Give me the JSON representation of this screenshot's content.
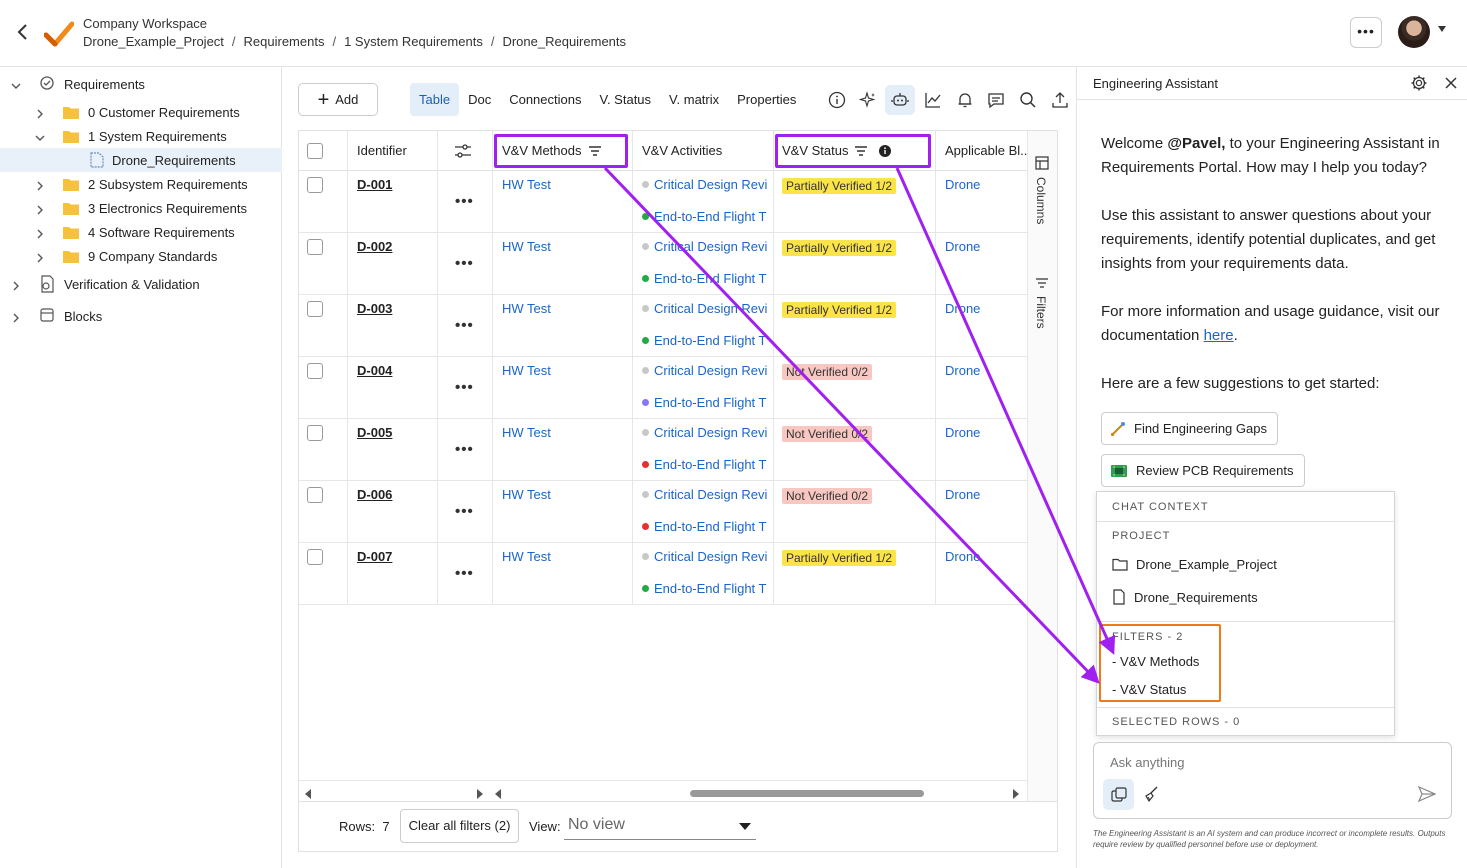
{
  "header": {
    "workspace": "Company Workspace",
    "breadcrumbs": [
      "Drone_Example_Project",
      "Requirements",
      "1 System Requirements",
      "Drone_Requirements"
    ],
    "more_label": "•••"
  },
  "sidebar": {
    "items": [
      {
        "label": "Requirements"
      },
      {
        "label": "0 Customer Requirements"
      },
      {
        "label": "1 System Requirements"
      },
      {
        "label": "Drone_Requirements"
      },
      {
        "label": "2 Subsystem Requirements"
      },
      {
        "label": "3 Electronics Requirements"
      },
      {
        "label": "4 Software Requirements"
      },
      {
        "label": "9 Company Standards"
      },
      {
        "label": "Verification & Validation"
      },
      {
        "label": "Blocks"
      }
    ]
  },
  "toolbar": {
    "add_label": "Add",
    "tabs": [
      "Table",
      "Doc",
      "Connections",
      "V. Status",
      "V. matrix",
      "Properties"
    ],
    "active_tab": "Table"
  },
  "table": {
    "columns": [
      "Identifier",
      "V&V Methods",
      "V&V Activities",
      "V&V Status",
      "Applicable Bl..."
    ],
    "rows": [
      {
        "id": "D-001",
        "method": "HW Test",
        "act1": "Critical Design Revi",
        "act2": "End-to-End Flight T",
        "act2_color": "#22aa44",
        "status": "Partially Verified 1/2",
        "status_kind": "partial",
        "block": "Drone"
      },
      {
        "id": "D-002",
        "method": "HW Test",
        "act1": "Critical Design Revi",
        "act2": "End-to-End Flight T",
        "act2_color": "#22aa44",
        "status": "Partially Verified 1/2",
        "status_kind": "partial",
        "block": "Drone"
      },
      {
        "id": "D-003",
        "method": "HW Test",
        "act1": "Critical Design Revi",
        "act2": "End-to-End Flight T",
        "act2_color": "#22aa44",
        "status": "Partially Verified 1/2",
        "status_kind": "partial",
        "block": "Drone"
      },
      {
        "id": "D-004",
        "method": "HW Test",
        "act1": "Critical Design Revi",
        "act2": "End-to-End Flight T",
        "act2_color": "#8877ee",
        "status": "Not Verified 0/2",
        "status_kind": "not",
        "block": "Drone"
      },
      {
        "id": "D-005",
        "method": "HW Test",
        "act1": "Critical Design Revi",
        "act2": "End-to-End Flight T",
        "act2_color": "#e53030",
        "status": "Not Verified 0/2",
        "status_kind": "not",
        "block": "Drone"
      },
      {
        "id": "D-006",
        "method": "HW Test",
        "act1": "Critical Design Revi",
        "act2": "End-to-End Flight T",
        "act2_color": "#e53030",
        "status": "Not Verified 0/2",
        "status_kind": "not",
        "block": "Drone"
      },
      {
        "id": "D-007",
        "method": "HW Test",
        "act1": "Critical Design Revi",
        "act2": "End-to-End Flight T",
        "act2_color": "#22aa44",
        "status": "Partially Verified 1/2",
        "status_kind": "partial",
        "block": "Drone"
      }
    ],
    "rail_columns": "Columns",
    "rail_filters": "Filters"
  },
  "footer": {
    "rows_label": "Rows:",
    "rows_count": "7",
    "clear_filters": "Clear all filters (2)",
    "view_label": "View:",
    "view_value": "No view"
  },
  "assistant": {
    "title": "Engineering Assistant",
    "welcome_pre": "Welcome ",
    "welcome_user": "@Pavel,",
    "welcome_post": " to your Engineering Assistant in Requirements Portal. How may I help you today?",
    "p2": "Use this assistant to answer questions about your requirements, identify potential duplicates, and get insights from your requirements data.",
    "p3_pre": "For more information and usage guidance, visit our documentation ",
    "p3_link": "here",
    "p3_post": ".",
    "p4": "Here are a few suggestions to get started:",
    "suggestions": [
      "Find Engineering Gaps",
      "Review PCB Requirements"
    ],
    "context": {
      "header": "CHAT CONTEXT",
      "project_header": "PROJECT",
      "project": "Drone_Example_Project",
      "document": "Drone_Requirements",
      "filters_header": "FILTERS - 2",
      "filters": [
        "- V&V Methods",
        "- V&V Status"
      ],
      "selected_rows": "SELECTED ROWS - 0"
    },
    "input_placeholder": "Ask anything",
    "disclaimer": "The Engineering Assistant is an AI system and can produce incorrect or incomplete results. Outputs require review by qualified personnel before use or deployment."
  }
}
